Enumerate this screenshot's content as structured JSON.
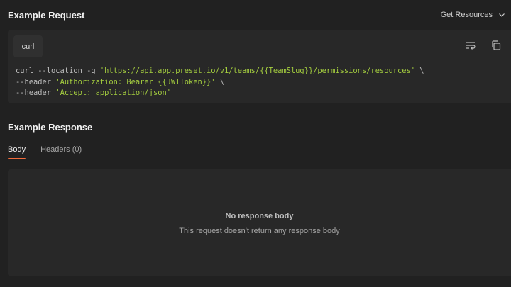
{
  "request": {
    "title": "Example Request",
    "dropdown_label": "Get Resources",
    "language_tab": "curl",
    "code": {
      "line1_cmd": "curl --location -g ",
      "line1_str": "'https://api.app.preset.io/v1/teams/{{TeamSlug}}/permissions/resources'",
      "line1_tail": " \\",
      "line2_cmd": "--header ",
      "line2_str": "'Authorization: Bearer {{JWTToken}}'",
      "line2_tail": " \\",
      "line3_cmd": "--header ",
      "line3_str": "'Accept: application/json'"
    }
  },
  "response": {
    "title": "Example Response",
    "tabs": [
      {
        "label": "Body",
        "active": true
      },
      {
        "label": "Headers (0)",
        "active": false
      }
    ],
    "empty_title": "No response body",
    "empty_subtitle": "This request doesn't return any response body"
  },
  "colors": {
    "accent": "#f26b3a",
    "string": "#a4cd3f",
    "background": "#212121",
    "panel": "#282828"
  }
}
